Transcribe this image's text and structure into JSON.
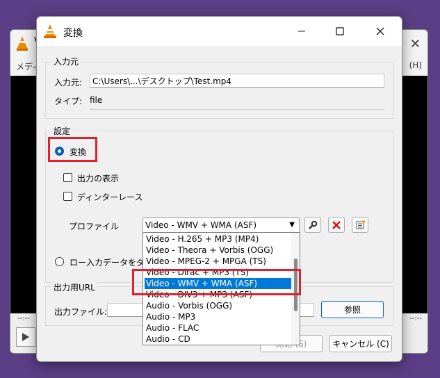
{
  "background_window": {
    "title_partial": "V",
    "menu_partial": "メディ",
    "help_partial": "(H)",
    "time_left": "--:--",
    "time_right": "--:--"
  },
  "dialog": {
    "title": "変換",
    "source_group": {
      "label": "入力元",
      "source_label": "入力元:",
      "source_value": "C:\\Users\\...\\デスクトップ\\Test.mp4",
      "type_label": "タイプ:",
      "type_value": "file"
    },
    "settings_group": {
      "label": "設定",
      "convert_radio": "変換",
      "show_output_checkbox": "出力の表示",
      "deinterlace_checkbox": "ディンターレース",
      "profile_label": "プロファイル",
      "profile_selected": "Video - WMV + WMA (ASF)",
      "raw_radio": "ロー入カデータをダン"
    },
    "profile_options": [
      "Video - H.265 + MP3 (MP4)",
      "Video - Theora + Vorbis (OGG)",
      "Video - MPEG-2 + MPGA (TS)",
      "Video - Dirac + MP3 (TS)",
      "Video - WMV + WMA (ASF)",
      "Video - DIV3 + MP3 (ASF)",
      "Audio - Vorbis (OGG)",
      "Audio - MP3",
      "Audio - FLAC",
      "Audio - CD"
    ],
    "selected_option_index": 4,
    "output_group": {
      "label": "出力用URL",
      "file_label": "出力ファイル:",
      "file_value": "",
      "browse_button": "参照"
    },
    "buttons": {
      "start": "開始 (S)",
      "cancel": "キャンセル (C)"
    }
  },
  "colors": {
    "highlight": "#e02030",
    "selection": "#0078d7",
    "desktop": "#5b3f86"
  }
}
